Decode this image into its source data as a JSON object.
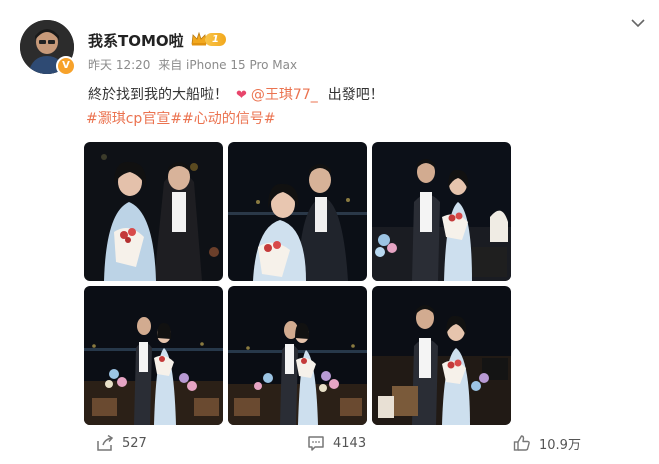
{
  "post": {
    "author": {
      "name": "我系TOMO啦",
      "vip_level": "1",
      "verified_mark": "V"
    },
    "time": "昨天 12:20",
    "source": "来自 iPhone 15 Pro Max",
    "text": {
      "main": "終於找到我的大船啦！",
      "mention": "@王琪77_",
      "tail": "出發吧！"
    },
    "topics": [
      "#灏琪cp官宣#",
      "#心动的信号#"
    ],
    "photos": [
      {
        "name": "photo-1"
      },
      {
        "name": "photo-2"
      },
      {
        "name": "photo-3"
      },
      {
        "name": "photo-4"
      },
      {
        "name": "photo-5"
      },
      {
        "name": "photo-6"
      }
    ]
  },
  "actions": {
    "share_count": "527",
    "comment_count": "4143",
    "like_count": "10.9万"
  },
  "colors": {
    "link": "#eb7350",
    "meta": "#8b8b8b",
    "heart": "#e8456b",
    "vip_gold": "#f2a81d"
  },
  "icons": [
    "chevron-down-icon",
    "crown-icon",
    "heart-icon",
    "share-icon",
    "comment-icon",
    "like-icon"
  ]
}
